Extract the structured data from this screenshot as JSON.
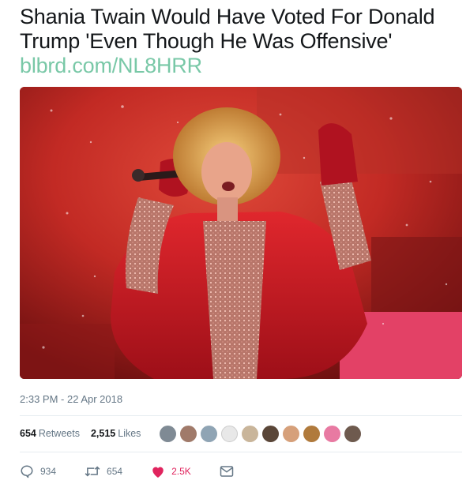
{
  "tweet": {
    "text_line1": "Shania Twain Would Have Voted For Donald",
    "text_line2": "Trump 'Even Though He Was Offensive'",
    "link": "blbrd.com/NL8HRR",
    "timestamp": "2:33 PM - 22 Apr 2018"
  },
  "stats": {
    "retweets_count": "654",
    "retweets_label": "Retweets",
    "likes_count": "2,515",
    "likes_label": "Likes"
  },
  "likers": [
    {
      "icon": "avatar"
    },
    {
      "icon": "avatar"
    },
    {
      "icon": "avatar"
    },
    {
      "icon": "avatar"
    },
    {
      "icon": "avatar"
    },
    {
      "icon": "avatar"
    },
    {
      "icon": "avatar"
    },
    {
      "icon": "avatar"
    },
    {
      "icon": "avatar"
    },
    {
      "icon": "avatar"
    }
  ],
  "actions": {
    "reply_count": "934",
    "retweet_count": "654",
    "like_count": "2.5K"
  },
  "colors": {
    "link": "#79c8a7",
    "like": "#e0245e",
    "muted": "#657786",
    "divider": "#e6ecf0"
  }
}
